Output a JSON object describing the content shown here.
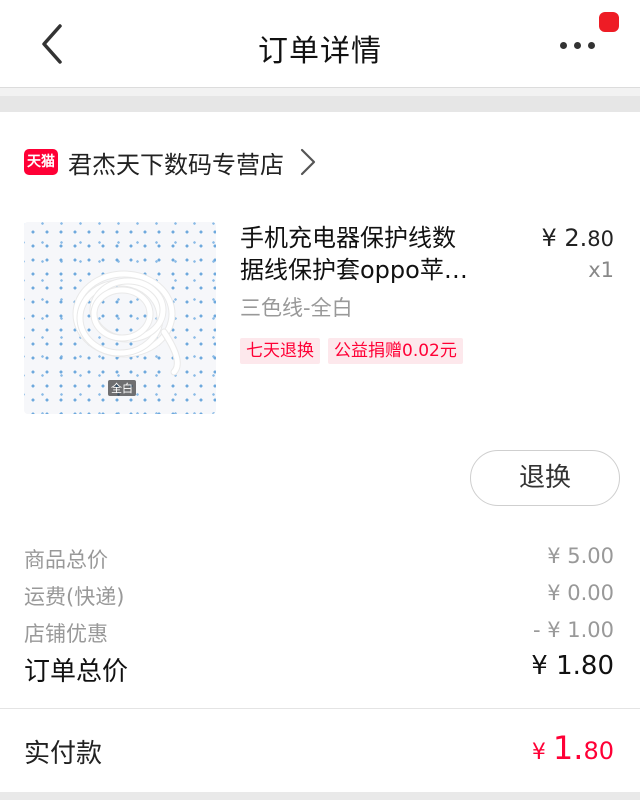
{
  "header": {
    "title": "订单详情",
    "back_icon": "chevron-left-icon",
    "more_icon": "ellipsis-icon",
    "badge_color": "#ee1c25"
  },
  "shop": {
    "logo_text": "天猫",
    "name": "君杰天下数码专营店",
    "brand_color": "#ff0036"
  },
  "product": {
    "title_line1": "手机充电器保护线数",
    "title_line2": "据线保护套oppo苹…",
    "variant": "三色线-全白",
    "image_label": "全白",
    "price_main": "¥ 2.",
    "price_cents": "80",
    "quantity": "x1",
    "tags": [
      "七天退换",
      "公益捐赠0.02元"
    ],
    "action_label": "退换"
  },
  "summary": {
    "rows": [
      {
        "label": "商品总价",
        "value": "¥ 5.00"
      },
      {
        "label": "运费(快递)",
        "value": "¥ 0.00"
      },
      {
        "label": "店铺优惠",
        "value": "- ¥ 1.00"
      }
    ],
    "total_label": "订单总价",
    "total_value": "¥ 1.80"
  },
  "payment": {
    "label": "实付款",
    "currency": "¥ ",
    "integer": "1.",
    "fraction": "80",
    "accent_color": "#ff0036"
  }
}
